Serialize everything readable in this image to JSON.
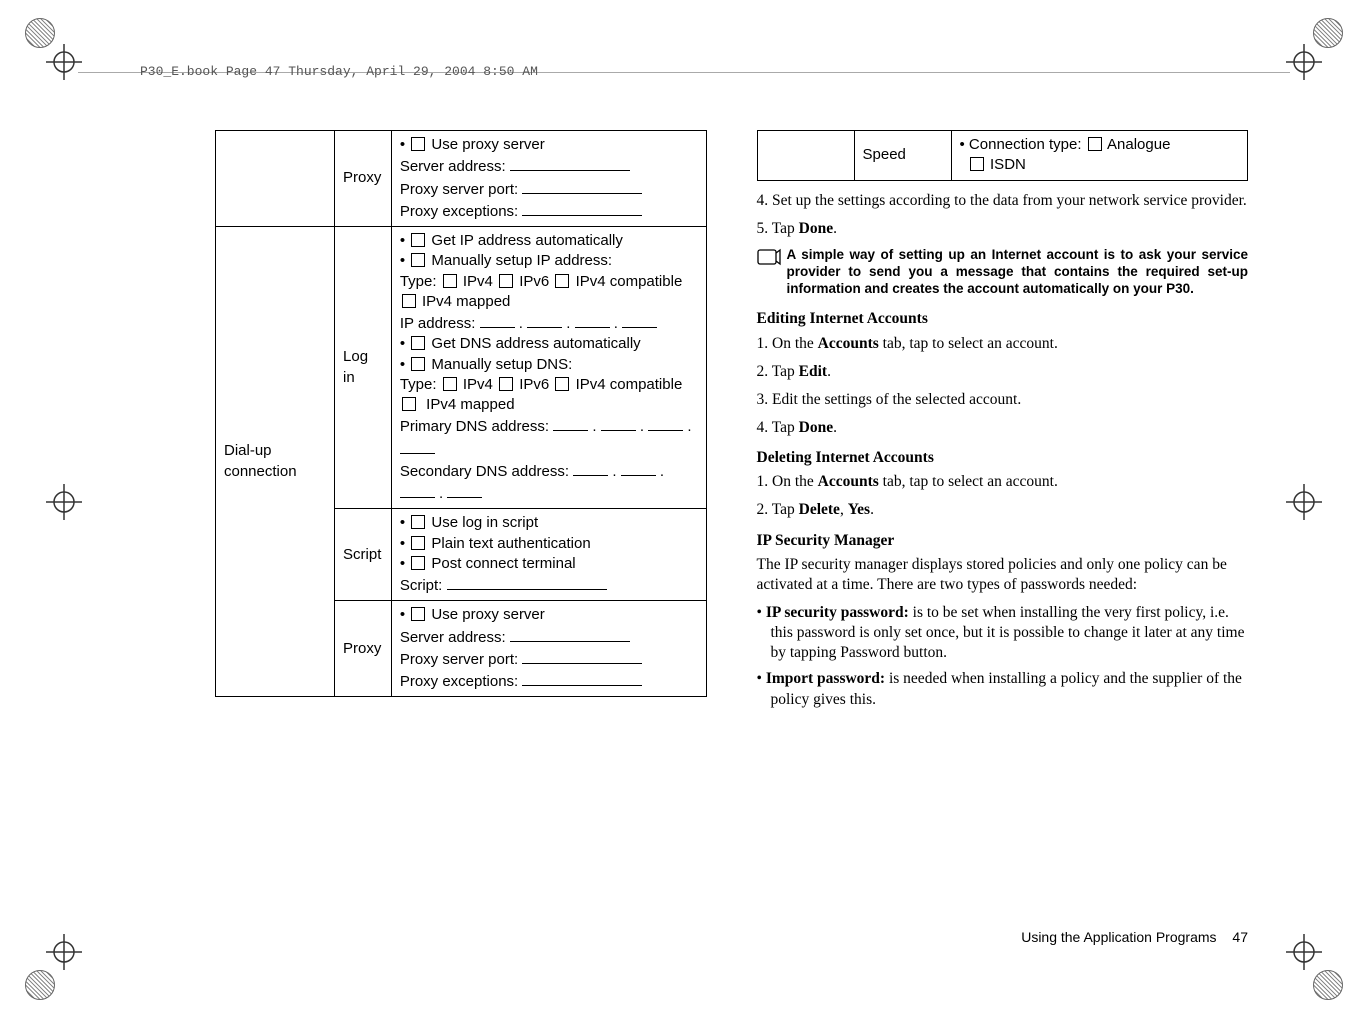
{
  "running_header": "P30_E.book  Page 47  Thursday, April 29, 2004  8:50 AM",
  "left_table": {
    "row1": {
      "col2": "Proxy",
      "cells": {
        "a": "Use proxy server",
        "b": "Server address:",
        "c": "Proxy server port:",
        "d": "Proxy exceptions:"
      }
    },
    "cat2": "Dial-up connection",
    "login": {
      "label": "Log in",
      "a": "Get IP address automatically",
      "b": "Manually setup IP address:",
      "type_prefix": "Type:",
      "t1": "IPv4",
      "t2": "IPv6",
      "t3": "IPv4 compatible",
      "t4": "IPv4 mapped",
      "ipaddr": "IP address:",
      "c": "Get DNS address automatically",
      "d": "Manually setup DNS:",
      "type2_t1": "IPv4",
      "type2_t2": "IPv6",
      "type2_t3": "IPv4 compatible",
      "type2_t4": "IPv4 mapped",
      "primary": "Primary DNS address:",
      "secondary": "Secondary DNS address:"
    },
    "script": {
      "label": "Script",
      "a": "Use log in script",
      "b": "Plain text authentication",
      "c": "Post connect terminal",
      "d": "Script:"
    },
    "proxy2": {
      "label": "Proxy",
      "a": "Use proxy server",
      "b": "Server address:",
      "c": "Proxy server port:",
      "d": "Proxy exceptions:"
    }
  },
  "right_table": {
    "speed_label": "Speed",
    "conn_prefix": "Connection type:",
    "opt1": "Analogue",
    "opt2": "ISDN"
  },
  "steps": {
    "s4": "4. Set up the settings according to the data from your network service provider.",
    "s5_pre": "5. Tap ",
    "s5_bold": "Done",
    "s5_post": "."
  },
  "note": "A simple way of setting up an Internet account is to ask your service provider to send you a message that contains the required set-up information and creates the account automatically on your P30.",
  "edit_heading": "Editing Internet Accounts",
  "edit1_pre": "1. On the ",
  "edit1_bold": "Accounts",
  "edit1_post": " tab, tap to select an account.",
  "edit2_pre": "2. Tap ",
  "edit2_bold": "Edit",
  "edit2_post": ".",
  "edit3": "3. Edit the settings of the selected account.",
  "edit4_pre": "4. Tap ",
  "edit4_bold": "Done",
  "edit4_post": ".",
  "del_heading": "Deleting Internet Accounts",
  "del1_pre": "1. On the ",
  "del1_bold": "Accounts",
  "del1_post": " tab, tap to select an account.",
  "del2_pre": "2. Tap ",
  "del2_bold1": "Delete",
  "del2_mid": ", ",
  "del2_bold2": "Yes",
  "del2_post": ".",
  "ip_heading": "IP Security Manager",
  "ip_body": "The IP security manager displays stored policies and only one policy can be activated at a time. There are two types of passwords needed:",
  "ip_b1_bold": "IP security password:",
  "ip_b1_rest": " is to be set when installing the very first policy, i.e. this password is only set once, but it is possible to change it later at any time by tapping Password button.",
  "ip_b2_bold": "Import password:",
  "ip_b2_rest": " is needed when installing a policy and the supplier of the policy gives this.",
  "footer": {
    "text": "Using the Application Programs",
    "page": "47"
  }
}
